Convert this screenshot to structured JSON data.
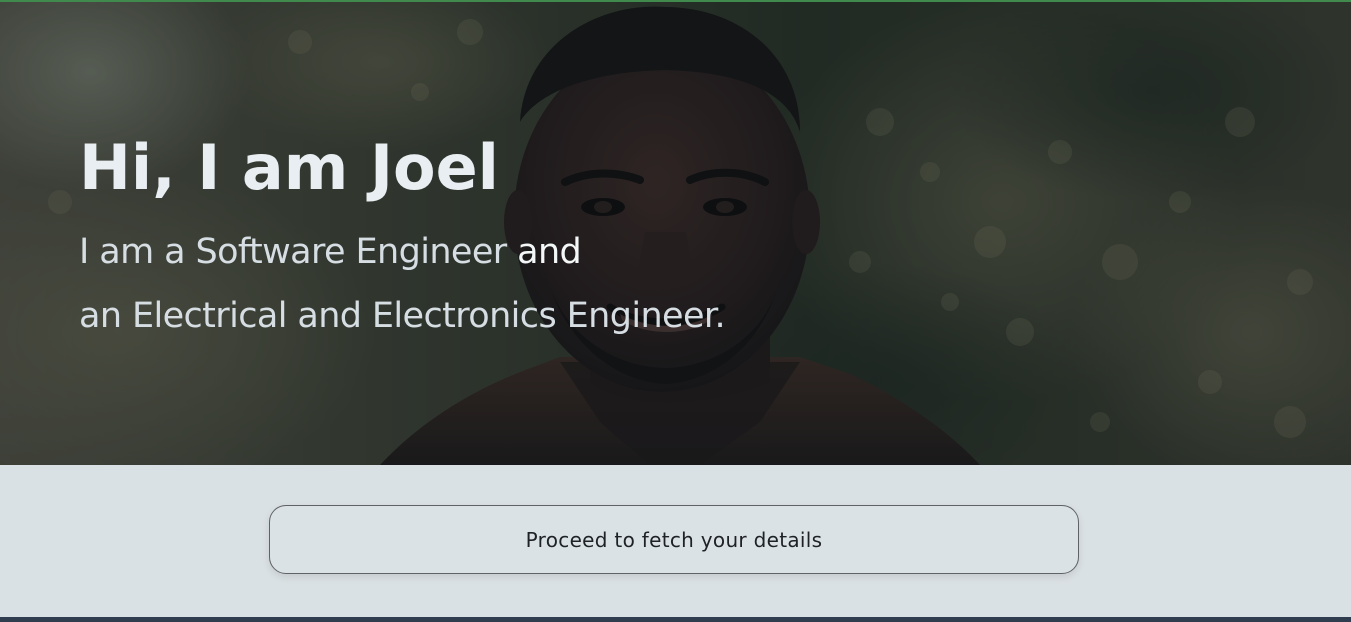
{
  "hero": {
    "title": "Hi, I am Joel",
    "subtitle_line1_main": "I am a Software Engineer ",
    "subtitle_line1_emph": "and",
    "subtitle_line2": "an Electrical and Electronics Engineer.",
    "photo": "portrait-photo"
  },
  "action": {
    "proceed_label": "Proceed to fetch your details"
  },
  "colors": {
    "top_accent": "#3f8a4c",
    "page_background": "#dae1e4",
    "bottom_bar": "#2f3d4f",
    "title_text": "#e8eef1"
  }
}
